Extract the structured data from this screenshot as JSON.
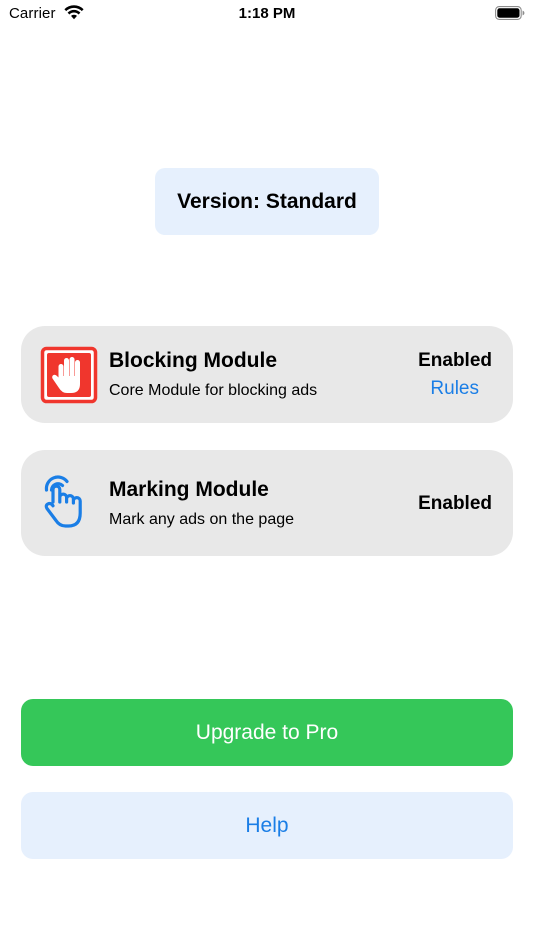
{
  "status_bar": {
    "carrier": "Carrier",
    "time": "1:18 PM",
    "wifi_icon": "wifi-icon",
    "battery_icon": "battery-icon"
  },
  "version": {
    "label": "Version: Standard"
  },
  "modules": [
    {
      "title": "Blocking Module",
      "description": "Core Module for blocking ads",
      "status": "Enabled",
      "link_label": "Rules",
      "icon": "stop-hand-icon",
      "icon_color": "#f0362d"
    },
    {
      "title": "Marking Module",
      "description": "Mark any ads on the page",
      "status": "Enabled",
      "icon": "tap-hand-icon",
      "icon_color": "#1a7ee6"
    }
  ],
  "buttons": {
    "upgrade_label": "Upgrade to Pro",
    "help_label": "Help"
  },
  "colors": {
    "accent_blue": "#1a7ee6",
    "upgrade_green": "#35c759",
    "card_gray": "#e8e8e8",
    "pale_blue": "#e6f0fd",
    "blocking_red": "#f0362d"
  }
}
